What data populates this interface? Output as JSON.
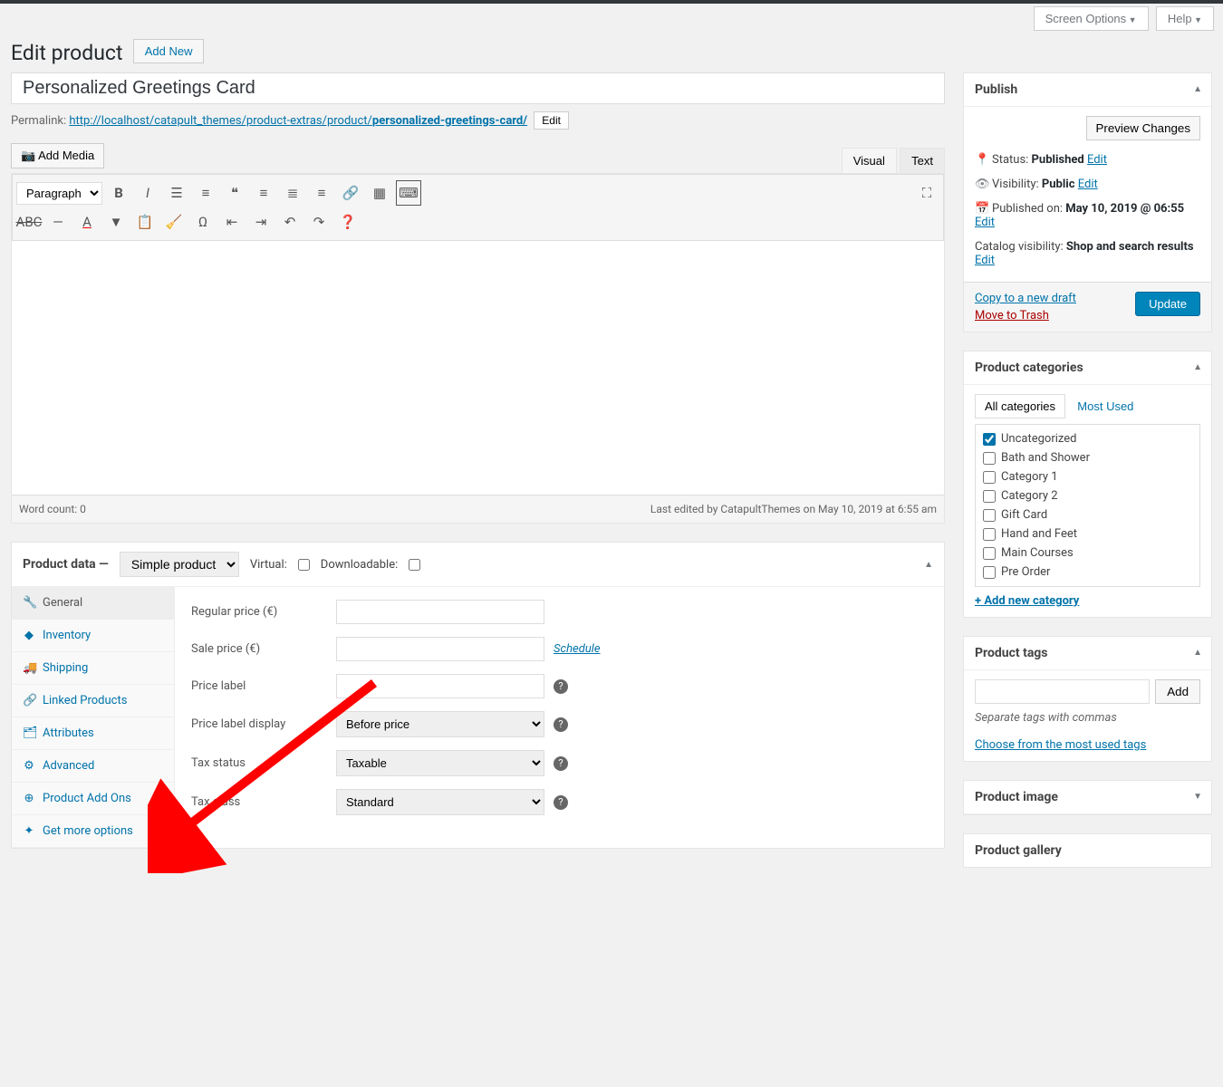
{
  "topbar": {
    "screen_options": "Screen Options",
    "help": "Help"
  },
  "page": {
    "heading": "Edit product",
    "add_new": "Add New",
    "title": "Personalized Greetings Card",
    "permalink_label": "Permalink:",
    "permalink_base": "http://localhost/catapult_themes/product-extras/product/",
    "permalink_slug": "personalized-greetings-card/",
    "edit_btn": "Edit"
  },
  "editor": {
    "add_media": "Add Media",
    "visual_tab": "Visual",
    "text_tab": "Text",
    "format_select": "Paragraph",
    "word_count_label": "Word count: 0",
    "last_edited": "Last edited by CatapultThemes on May 10, 2019 at 6:55 am"
  },
  "publish": {
    "title": "Publish",
    "preview": "Preview Changes",
    "status_label": "Status: ",
    "status_value": "Published",
    "edit": "Edit",
    "visibility_label": "Visibility: ",
    "visibility_value": "Public",
    "published_on_label": "Published on: ",
    "published_on_value": "May 10, 2019 @ 06:55",
    "catalog_label": "Catalog visibility: ",
    "catalog_value": "Shop and search results",
    "copy_draft": "Copy to a new draft",
    "move_trash": "Move to Trash",
    "update_btn": "Update"
  },
  "categories": {
    "title": "Product categories",
    "all_tab": "All categories",
    "most_used_tab": "Most Used",
    "items": [
      "Uncategorized",
      "Bath and Shower",
      "Category 1",
      "Category 2",
      "Gift Card",
      "Hand and Feet",
      "Main Courses",
      "Pre Order"
    ],
    "checked_index": 0,
    "add_new": "+ Add new category"
  },
  "tags": {
    "title": "Product tags",
    "add_btn": "Add",
    "hint": "Separate tags with commas",
    "choose_link": "Choose from the most used tags"
  },
  "product_image": {
    "title": "Product image"
  },
  "product_gallery": {
    "title": "Product gallery"
  },
  "product_data": {
    "title": "Product data —",
    "type": "Simple product",
    "virtual_label": "Virtual:",
    "downloadable_label": "Downloadable:",
    "tabs": [
      {
        "label": "General",
        "icon": "🔧",
        "active": true
      },
      {
        "label": "Inventory",
        "icon": "◆",
        "active": false
      },
      {
        "label": "Shipping",
        "icon": "🚚",
        "active": false
      },
      {
        "label": "Linked Products",
        "icon": "🔗",
        "active": false
      },
      {
        "label": "Attributes",
        "icon": "🗂",
        "active": false
      },
      {
        "label": "Advanced",
        "icon": "⚙",
        "active": false
      },
      {
        "label": "Product Add Ons",
        "icon": "⊕",
        "active": false
      },
      {
        "label": "Get more options",
        "icon": "✦",
        "active": false
      }
    ],
    "fields": {
      "regular_price": "Regular price (€)",
      "sale_price": "Sale price (€)",
      "schedule": "Schedule",
      "price_label": "Price label",
      "price_label_display": "Price label display",
      "price_label_display_value": "Before price",
      "tax_status": "Tax status",
      "tax_status_value": "Taxable",
      "tax_class": "Tax class",
      "tax_class_value": "Standard"
    }
  }
}
